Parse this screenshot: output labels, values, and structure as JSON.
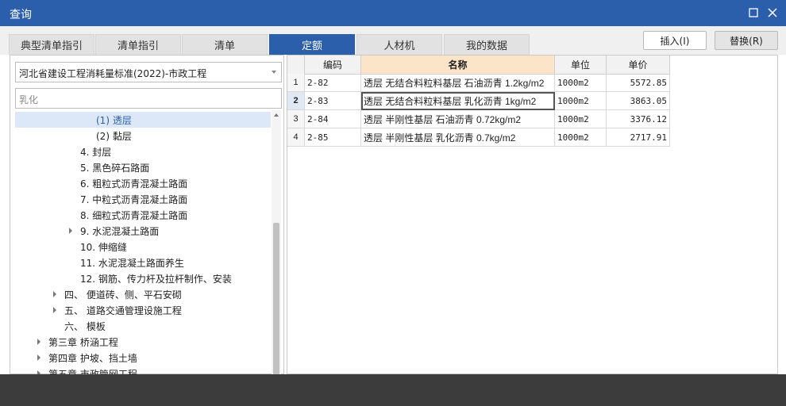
{
  "window": {
    "title": "查询"
  },
  "tabs": [
    {
      "label": "典型清单指引"
    },
    {
      "label": "清单指引"
    },
    {
      "label": "清单"
    },
    {
      "label": "定额"
    },
    {
      "label": "人材机"
    },
    {
      "label": "我的数据"
    }
  ],
  "actions": {
    "insert_label": "插入(I)",
    "replace_label": "替换(R)"
  },
  "left": {
    "selected_library": "河北省建设工程消耗量标准(2022)-市政工程",
    "search_value": "乳化"
  },
  "tree": [
    {
      "label": "(1) 透层"
    },
    {
      "label": "(2) 黏层"
    },
    {
      "label": "4. 封层"
    },
    {
      "label": "5. 黑色碎石路面"
    },
    {
      "label": "6. 粗粒式沥青混凝土路面"
    },
    {
      "label": "7. 中粒式沥青混凝土路面"
    },
    {
      "label": "8. 细粒式沥青混凝土路面"
    },
    {
      "label": "9. 水泥混凝土路面"
    },
    {
      "label": "10. 伸缩缝"
    },
    {
      "label": "11. 水泥混凝土路面养生"
    },
    {
      "label": "12. 钢筋、传力杆及拉杆制作、安装"
    },
    {
      "label": "四、 便道砖、侧、平石安砌"
    },
    {
      "label": "五、 道路交通管理设施工程"
    },
    {
      "label": "六、 模板"
    },
    {
      "label": "第三章 桥涵工程"
    },
    {
      "label": "第四章 护坡、挡土墙"
    },
    {
      "label": "第五章 市政管网工程"
    }
  ],
  "grid": {
    "headers": {
      "code": "编码",
      "name": "名称",
      "unit": "单位",
      "price": "单价"
    },
    "rows": [
      {
        "num": "1",
        "code": "2-82",
        "name": "透层 无结合料粒料基层 石油沥青 1.2kg/m2",
        "unit": "1000m2",
        "price": "5572.85"
      },
      {
        "num": "2",
        "code": "2-83",
        "name": "透层 无结合料粒料基层 乳化沥青 1kg/m2",
        "unit": "1000m2",
        "price": "3863.05"
      },
      {
        "num": "3",
        "code": "2-84",
        "name": "透层 半刚性基层 石油沥青 0.72kg/m2",
        "unit": "1000m2",
        "price": "3376.12"
      },
      {
        "num": "4",
        "code": "2-85",
        "name": "透层 半刚性基层 乳化沥青 0.7kg/m2",
        "unit": "1000m2",
        "price": "2717.91"
      }
    ]
  }
}
